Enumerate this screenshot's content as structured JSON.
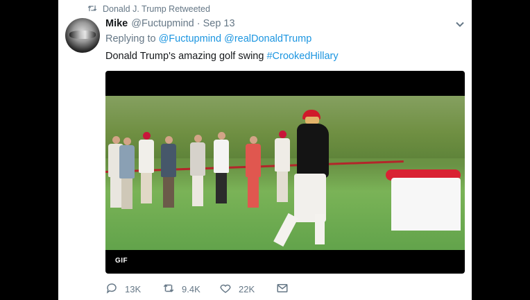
{
  "retweet_context": {
    "label": "Donald J. Trump Retweeted"
  },
  "tweet": {
    "display_name": "Mike",
    "handle": "@Fuctupmind",
    "separator": "·",
    "date": "Sep 13",
    "replying_prefix": "Replying to",
    "reply_mentions": [
      "@Fuctupmind",
      "@realDonaldTrump"
    ],
    "text": "Donald Trump's amazing golf swing ",
    "hashtag": "#CrookedHillary",
    "media_badge": "GIF"
  },
  "actions": {
    "reply_count": "13K",
    "retweet_count": "9.4K",
    "like_count": "22K"
  },
  "colors": {
    "link": "#1b95e0",
    "muted": "#657786",
    "text": "#14171a"
  }
}
